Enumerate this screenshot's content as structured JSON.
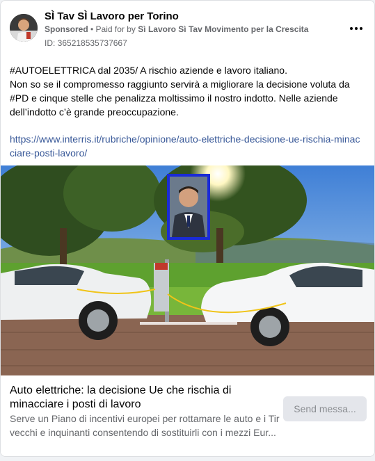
{
  "post": {
    "page_name": "SÌ Tav SÌ Lavoro per Torino",
    "sponsored_label": "Sponsored",
    "paid_for_prefix": "• Paid for by",
    "funder": "Sì Lavoro Sì Tav Movimento per la Crescita",
    "ad_id": "ID: 365218535737667",
    "text_lines": [
      "#AUTOELETTRICA dal 2035/ A rischio aziende e lavoro italiano.",
      "Non so se il compromesso raggiunto servirà a migliorare la decisione voluta da #PD e cinque stelle che penalizza moltissimo il nostro indotto. Nelle aziende dell’indotto c’è grande preoccupazione."
    ],
    "link": "https://www.interris.it/rubriche/opinione/auto-elettriche-decisione-ue-rischia-minacciare-posti-lavoro/",
    "more_icon": "more-horizontal-icon"
  },
  "preview": {
    "title": "Auto elettriche: la decisione Ue che rischia di minacciare i posti di lavoro",
    "desc_line1": "Serve un Piano di incentivi europei per rottamare le auto e i Tir",
    "desc_line2": "vecchi e inquinanti consentendo di sostituirli con i mezzi Eur...",
    "send_button": "Send messa..."
  },
  "colors": {
    "link": "#385898",
    "muted": "#65676b",
    "portrait_frame": "#1a2bd6"
  }
}
